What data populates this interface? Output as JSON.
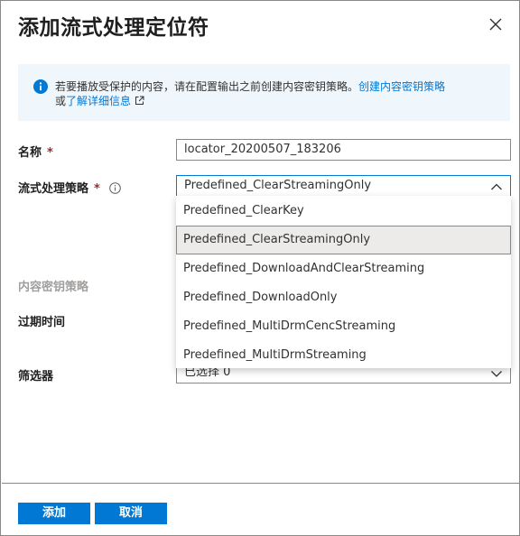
{
  "dialog": {
    "title": "添加流式处理定位符"
  },
  "info": {
    "text": "若要播放受保护的内容，请在配置输出之前创建内容密钥策略。",
    "link_create": "创建内容密钥策略",
    "or": "或",
    "link_learn": "了解详细信息"
  },
  "form": {
    "name_label": "名称",
    "required_mark": "*",
    "name_value": "locator_20200507_183206",
    "policy_label": "流式处理策略",
    "policy_value": "Predefined_ClearStreamingOnly",
    "content_key_label": "内容密钥策略",
    "expiry_label": "过期时间",
    "filter_label": "筛选器",
    "filter_value": "已选择 0"
  },
  "dropdown": {
    "options": [
      "Predefined_ClearKey",
      "Predefined_ClearStreamingOnly",
      "Predefined_DownloadAndClearStreaming",
      "Predefined_DownloadOnly",
      "Predefined_MultiDrmCencStreaming",
      "Predefined_MultiDrmStreaming"
    ],
    "selected_index": 1
  },
  "footer": {
    "add_label": "添加",
    "cancel_label": "取消"
  },
  "colors": {
    "accent": "#0078d4",
    "info_bg": "#eff6fc",
    "required": "#a4262c"
  }
}
